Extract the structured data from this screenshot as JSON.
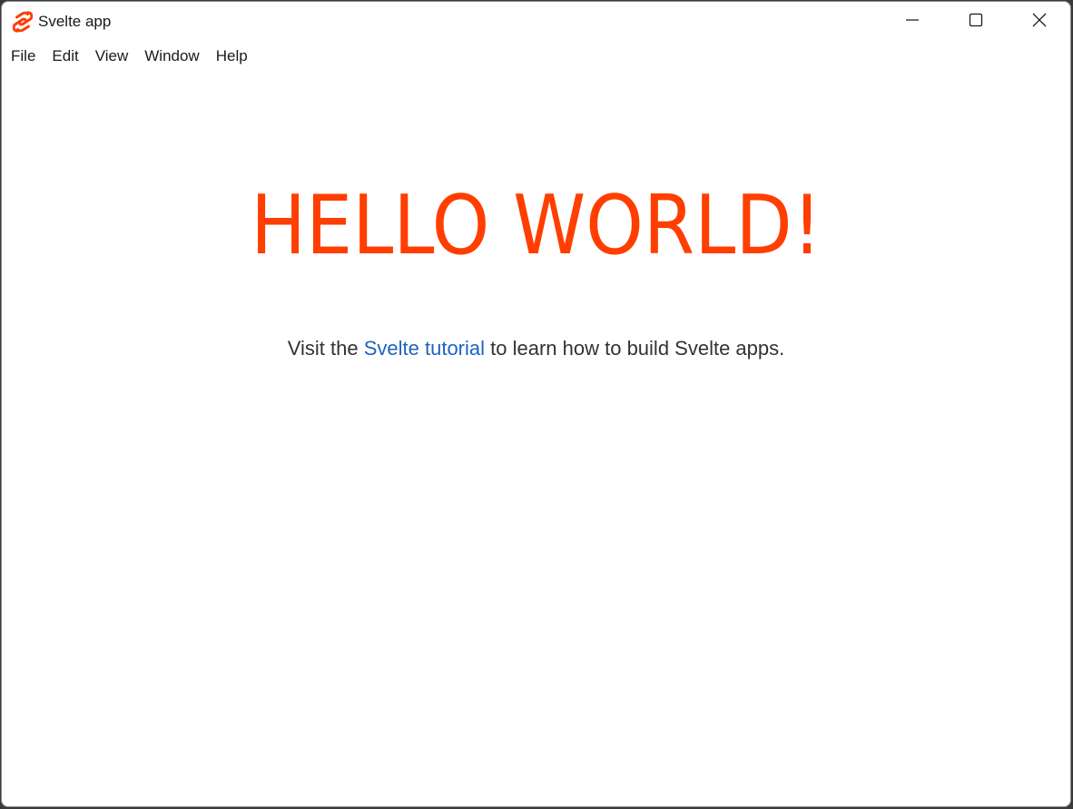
{
  "window": {
    "title": "Svelte app",
    "icon": "svelte-logo-icon",
    "controls": {
      "minimize": "minimize-icon",
      "maximize": "maximize-icon",
      "close": "close-icon"
    }
  },
  "menu": {
    "items": [
      {
        "label": "File"
      },
      {
        "label": "Edit"
      },
      {
        "label": "View"
      },
      {
        "label": "Window"
      },
      {
        "label": "Help"
      }
    ]
  },
  "main": {
    "heading": "HELLO WORLD!",
    "text_before": "Visit the ",
    "link_text": "Svelte tutorial",
    "text_after": " to learn how to build Svelte apps."
  },
  "colors": {
    "accent": "#ff3e00",
    "link": "#1f63bf",
    "text": "#333333"
  }
}
